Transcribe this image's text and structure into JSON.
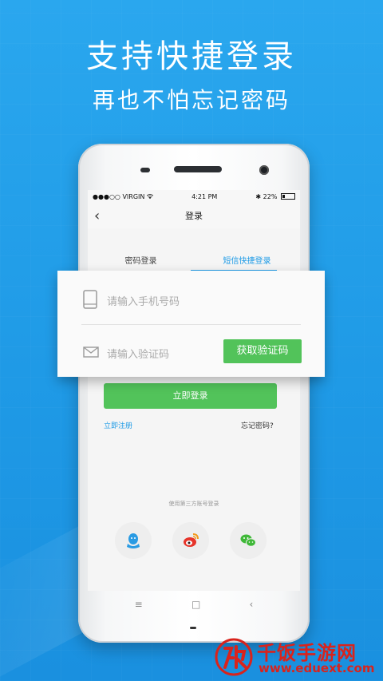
{
  "banner": {
    "headline": "支持快捷登录",
    "subheadline": "再也不怕忘记密码"
  },
  "status_bar": {
    "carrier": "VIRGIN",
    "time": "4:21 PM",
    "battery": "22%"
  },
  "nav": {
    "back_icon": "chevron-left-icon",
    "title": "登录"
  },
  "tabs": [
    {
      "label": "密码登录",
      "active": false
    },
    {
      "label": "短信快捷登录",
      "active": true
    }
  ],
  "form": {
    "phone_placeholder": "请输入手机号码",
    "code_placeholder": "请输入验证码",
    "get_code_label": "获取验证码",
    "login_label": "立即登录",
    "register_label": "立即注册",
    "forgot_label": "忘记密码?"
  },
  "third_party": {
    "caption": "使用第三方账号登录",
    "providers": [
      "qq-icon",
      "weibo-icon",
      "wechat-icon"
    ]
  },
  "colors": {
    "background": "#1f9ae6",
    "accent_blue": "#1e9be6",
    "button_green": "#52c35a",
    "watermark_red": "#d9231c"
  },
  "watermark": {
    "title": "千饭手游网",
    "url": "www.eduext.com"
  }
}
